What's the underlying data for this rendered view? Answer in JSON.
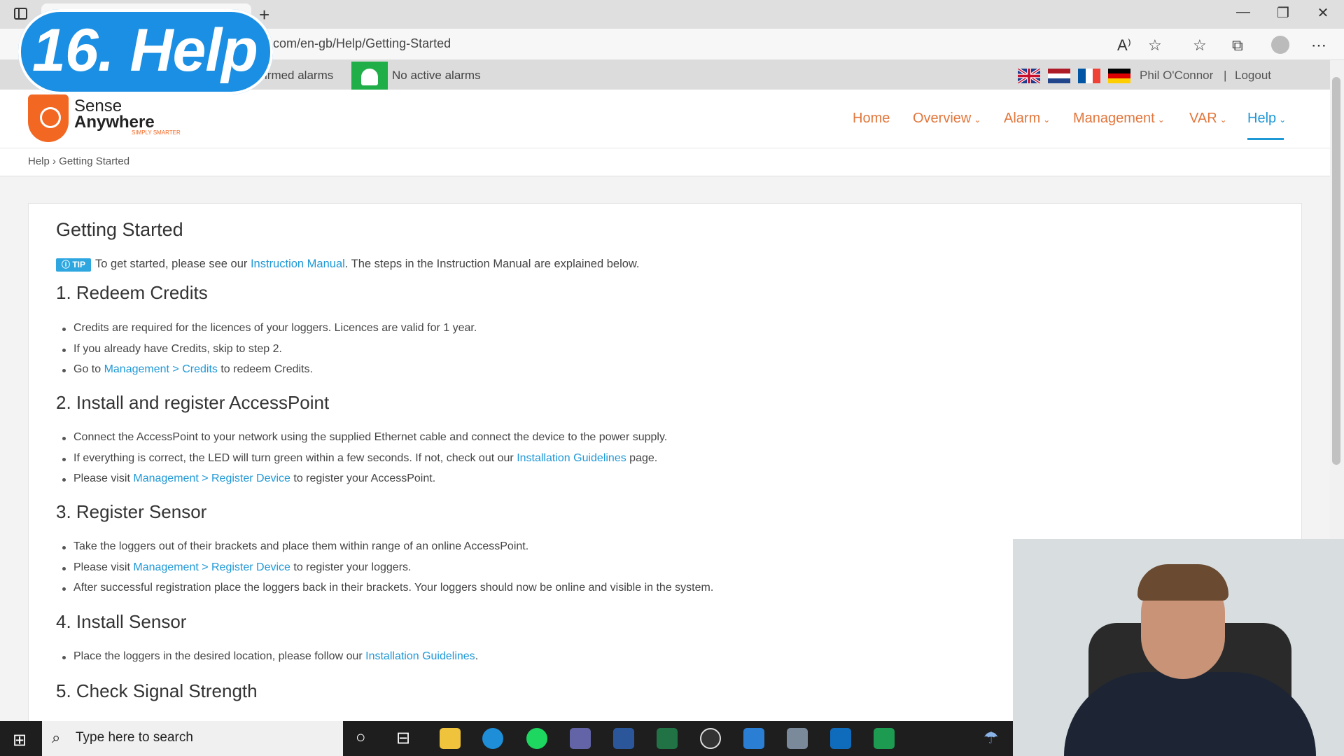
{
  "browser": {
    "new_tab_glyph": "+",
    "url": "t.com/en-gb/Help/Getting-Started",
    "window_controls": [
      "—",
      "❐",
      "✕"
    ]
  },
  "overlay": {
    "title": "16. Help"
  },
  "alarm_bar": {
    "unconfirmed": "irmed alarms",
    "active": "No active alarms"
  },
  "user": {
    "name": "Phil O'Connor",
    "separator": "|",
    "logout": "Logout"
  },
  "logo": {
    "line1": "Sense",
    "line2": "Anywhere",
    "tagline": "SIMPLY SMARTER"
  },
  "nav": {
    "home": "Home",
    "overview": "Overview",
    "alarm": "Alarm",
    "management": "Management",
    "var": "VAR",
    "help": "Help"
  },
  "breadcrumb": "Help › Getting Started",
  "page": {
    "title": "Getting Started",
    "tip_badge": "ⓘ TIP",
    "tip_pre": "To get started, please see our ",
    "tip_link": "Instruction Manual",
    "tip_post": ". The steps in the Instruction Manual are explained below.",
    "s1": "1. Redeem Credits",
    "s1_b1": "Credits are required for the licences of your loggers. Licences are valid for 1 year.",
    "s1_b2": "If you already have Credits, skip to step 2.",
    "s1_b3_pre": "Go to ",
    "s1_b3_link": "Management > Credits",
    "s1_b3_post": " to redeem Credits.",
    "s2": "2. Install and register AccessPoint",
    "s2_b1": "Connect the AccessPoint to your network using the supplied Ethernet cable and connect the device to the power supply.",
    "s2_b2_pre": "If everything is correct, the LED will turn green within a few seconds. If not, check out our ",
    "s2_b2_link": "Installation Guidelines",
    "s2_b2_post": " page.",
    "s2_b3_pre": "Please visit ",
    "s2_b3_link": "Management > Register Device",
    "s2_b3_post": " to register your AccessPoint.",
    "s3": "3. Register Sensor",
    "s3_b1": "Take the loggers out of their brackets and place them within range of an online AccessPoint.",
    "s3_b2_pre": "Please visit ",
    "s3_b2_link": "Management > Register Device",
    "s3_b2_post": " to register your loggers.",
    "s3_b3": "After successful registration place the loggers back in their brackets. Your loggers should now be online and visible in the system.",
    "s4": "4. Install Sensor",
    "s4_b1_pre": "Place the loggers in the desired location, please follow our ",
    "s4_b1_link": "Installation Guidelines",
    "s4_b1_post": ".",
    "s5": "5. Check Signal Strength"
  },
  "taskbar": {
    "search_placeholder": "Type here to search"
  },
  "colors": {
    "brand_orange": "#f26722",
    "link_blue": "#1f98d6",
    "alarm_green": "#1fae48",
    "overlay_blue": "#1a8fe3"
  }
}
